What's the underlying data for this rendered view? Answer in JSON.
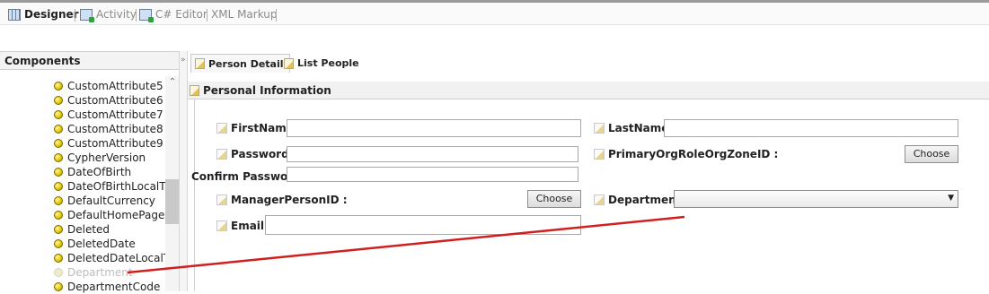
{
  "view_tabs": [
    {
      "label": "Designer",
      "active": true,
      "icon": "grid-icon"
    },
    {
      "label": "Activity",
      "active": false,
      "icon": "activity-icon"
    },
    {
      "label": "C# Editor",
      "active": false,
      "icon": "code-editor-icon"
    },
    {
      "label": "XML Markup",
      "active": false,
      "icon": ""
    }
  ],
  "components": {
    "title": "Components",
    "items": [
      {
        "label": "CustomAttribute5"
      },
      {
        "label": "CustomAttribute6"
      },
      {
        "label": "CustomAttribute7"
      },
      {
        "label": "CustomAttribute8"
      },
      {
        "label": "CustomAttribute9"
      },
      {
        "label": "CypherVersion"
      },
      {
        "label": "DateOfBirth"
      },
      {
        "label": "DateOfBirthLocalTim"
      },
      {
        "label": "DefaultCurrency"
      },
      {
        "label": "DefaultHomePage"
      },
      {
        "label": "Deleted"
      },
      {
        "label": "DeletedDate"
      },
      {
        "label": "DeletedDateLocalTin"
      },
      {
        "label": "Department",
        "dimmed": true
      },
      {
        "label": "DepartmentCode"
      }
    ]
  },
  "splitter_glyph": "»",
  "doc_tabs": [
    {
      "label": "Person Detail",
      "active": true
    },
    {
      "label": "List People",
      "active": false
    }
  ],
  "section": {
    "title": "Personal Information"
  },
  "form": {
    "first_name_label": "FirstName :",
    "last_name_label": "LastName :",
    "password_label": "Password :",
    "primary_org_label": "PrimaryOrgRoleOrgZoneID :",
    "confirm_password_label": "Confirm Password",
    "manager_label": "ManagerPersonID :",
    "department_label": "Department :",
    "email_label": "Email :",
    "choose_label": "Choose",
    "first_name_value": "",
    "last_name_value": "",
    "password_value": "",
    "confirm_password_value": "",
    "email_value": "",
    "department_value": ""
  },
  "colors": {
    "drag_line": "#d01f1f",
    "component_dot": "#e0c400"
  }
}
